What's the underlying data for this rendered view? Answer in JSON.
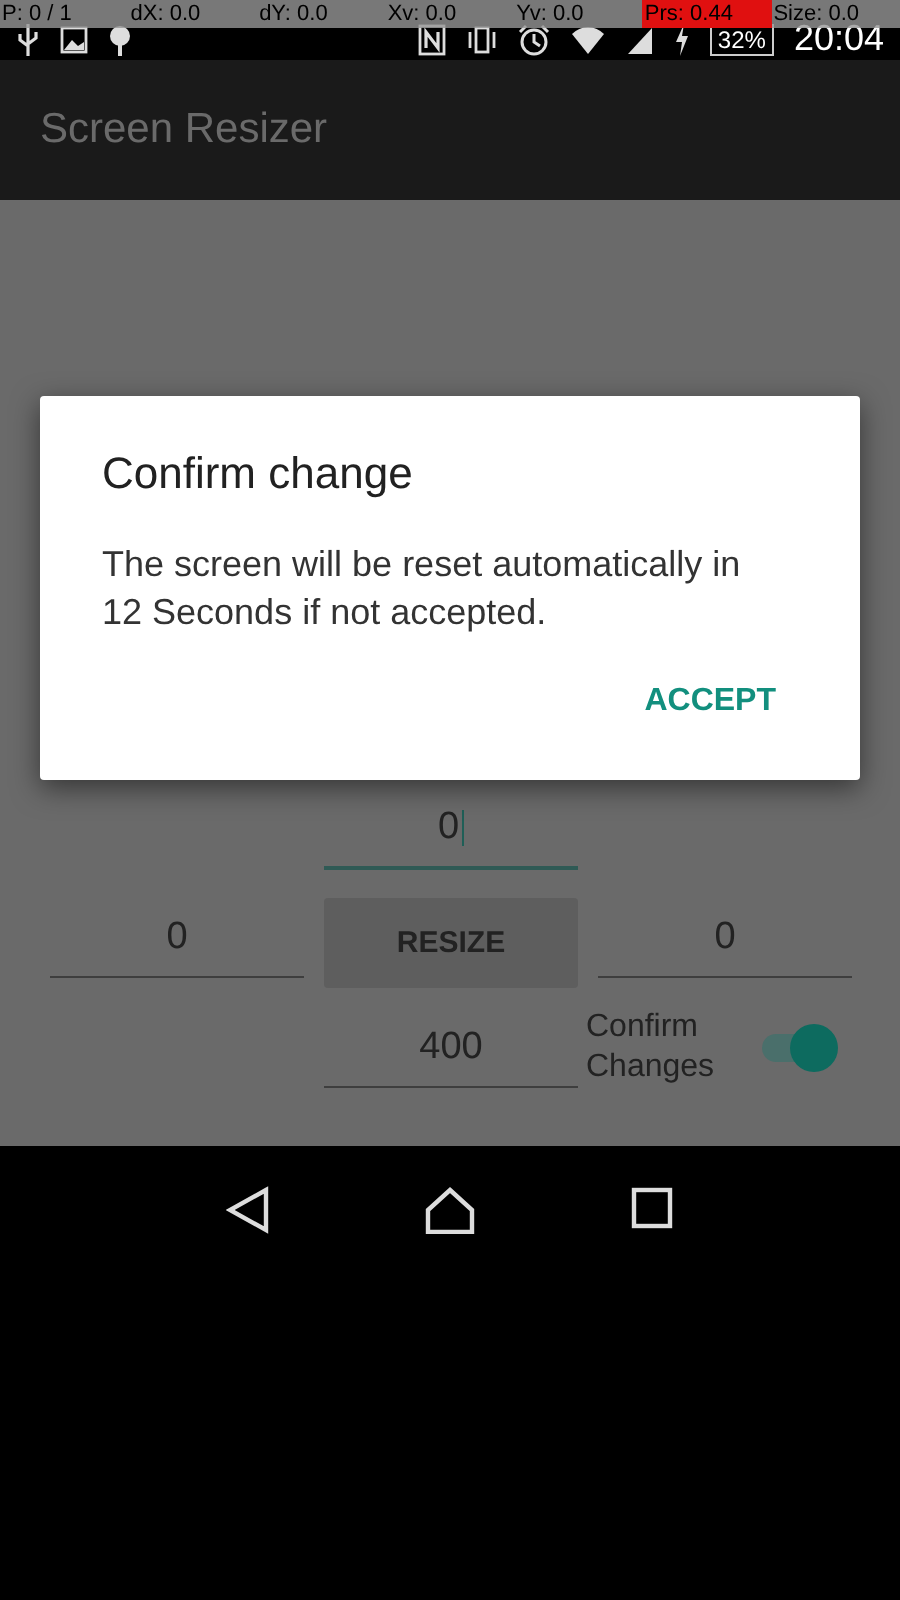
{
  "debug_overlay": [
    {
      "text": "P: 0 / 1",
      "highlighted": false
    },
    {
      "text": "dX: 0.0",
      "highlighted": false
    },
    {
      "text": "dY: 0.0",
      "highlighted": false
    },
    {
      "text": "Xv: 0.0",
      "highlighted": false
    },
    {
      "text": "Yv: 0.0",
      "highlighted": false
    },
    {
      "text": "Prs: 0.44",
      "highlighted": true
    },
    {
      "text": "Size: 0.0",
      "highlighted": false
    }
  ],
  "status_bar": {
    "battery": "32%",
    "time": "20:04"
  },
  "app_bar": {
    "title": "Screen Resizer"
  },
  "form": {
    "top_field": {
      "value": "0",
      "focused": true
    },
    "left_field": {
      "value": "0",
      "focused": false
    },
    "resize_button": "RESIZE",
    "right_field": {
      "value": "0",
      "focused": false
    },
    "bottom_field": {
      "value": "400",
      "focused": false
    },
    "confirm_toggle": {
      "label": "Confirm Changes",
      "on": true
    }
  },
  "dialog": {
    "title": "Confirm change",
    "message": "The screen will be reset automatically in 12 Seconds if not accepted.",
    "button": "ACCEPT"
  }
}
